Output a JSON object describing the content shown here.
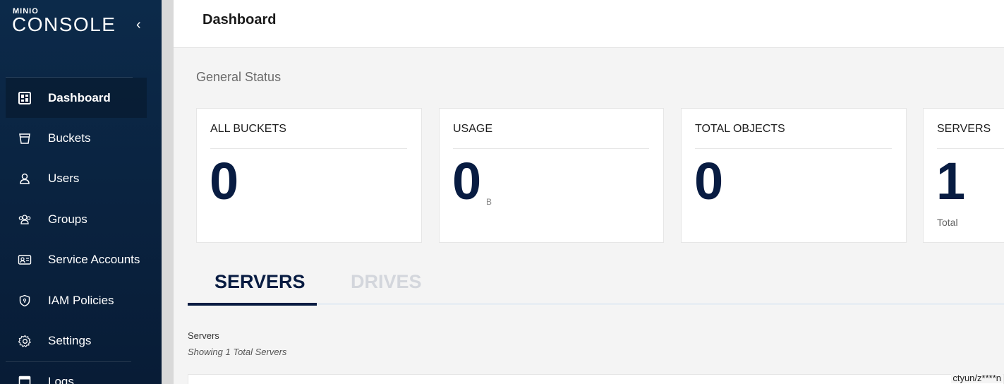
{
  "brand": {
    "small": "MINIO",
    "big": "CONSOLE",
    "collapse_glyph": "‹"
  },
  "sidebar": {
    "items": [
      {
        "label": "Dashboard",
        "icon": "dashboard-icon",
        "active": true
      },
      {
        "label": "Buckets",
        "icon": "bucket-icon"
      },
      {
        "label": "Users",
        "icon": "user-icon"
      },
      {
        "label": "Groups",
        "icon": "groups-icon"
      },
      {
        "label": "Service Accounts",
        "icon": "service-accounts-icon"
      },
      {
        "label": "IAM Policies",
        "icon": "shield-icon"
      },
      {
        "label": "Settings",
        "icon": "gear-icon"
      },
      {
        "label": "Logs",
        "icon": "logs-icon"
      }
    ]
  },
  "header": {
    "title": "Dashboard"
  },
  "general_status": {
    "title": "General Status",
    "cards": [
      {
        "label": "ALL BUCKETS",
        "value": "0"
      },
      {
        "label": "USAGE",
        "value": "0",
        "unit": "B"
      },
      {
        "label": "TOTAL OBJECTS",
        "value": "0"
      },
      {
        "label": "SERVERS",
        "value": "1",
        "sub": "Total"
      }
    ]
  },
  "tabs": [
    {
      "label": "SERVERS",
      "active": true
    },
    {
      "label": "DRIVES",
      "active": false
    }
  ],
  "servers": {
    "heading": "Servers",
    "subheading": "Showing 1 Total Servers"
  },
  "footer": {
    "user": "ctyun/z****n"
  },
  "colors": {
    "sidebar": "#0c2a4a",
    "accent": "#081c42",
    "inactive_tab": "#d3d6dc"
  }
}
